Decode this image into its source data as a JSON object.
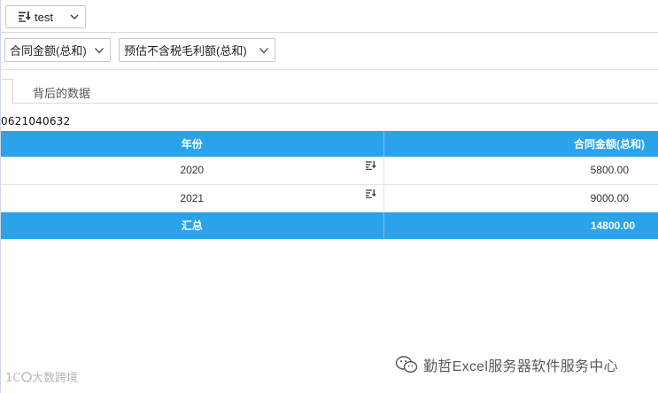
{
  "toolbar": {
    "test_label": "test",
    "sort_icon": "sort-desc-icon",
    "chevron_icon": "chevron-down-icon"
  },
  "filters": [
    {
      "label": "合同金额(总和)"
    },
    {
      "label": "预估不含税毛利额(总和)"
    }
  ],
  "tabs": {
    "data_behind_label": "背后的数据"
  },
  "record_id": "0621040632",
  "table": {
    "columns": [
      "年份",
      "合同金额(总和)"
    ],
    "rows": [
      {
        "year": "2020",
        "amount": "5800.00"
      },
      {
        "year": "2021",
        "amount": "9000.00"
      }
    ],
    "total_label": "汇总",
    "total_value": "14800.00"
  },
  "watermark": {
    "left_text": "大数跨境",
    "right_text": "勤哲Excel服务器软件服务中心"
  },
  "colors": {
    "header": "#2aa3ea",
    "text": "#222222",
    "border": "#d9d9d9"
  }
}
